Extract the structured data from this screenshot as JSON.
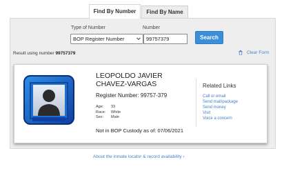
{
  "tabs": [
    {
      "label": "Find By Number",
      "active": true
    },
    {
      "label": "Find By Name",
      "active": false
    }
  ],
  "search": {
    "type_label": "Type of Number",
    "type_value": "BOP Register Number",
    "number_label": "Number",
    "number_value": "99757379",
    "search_button": "Search"
  },
  "result": {
    "prefix": "Result using number",
    "number": "99757379",
    "clear_label": "Clear Form"
  },
  "inmate": {
    "name": "LEOPOLDO JAVIER CHAVEZ-VARGAS",
    "register": "Register Number: 99757-379",
    "facts": [
      {
        "key": "Age:",
        "value": "33"
      },
      {
        "key": "Race:",
        "value": "White"
      },
      {
        "key": "Sex:",
        "value": "Male"
      }
    ],
    "custody": "Not in BOP Custody as of: 07/06/2021"
  },
  "related": {
    "title": "Related Links",
    "links": [
      "Call or email",
      "Send mail/package",
      "Send money",
      "Visit",
      "Voice a concern"
    ]
  },
  "footer": {
    "about": "About the inmate locator & record availability ›"
  },
  "colors": {
    "accent": "#3b8fd9",
    "link": "#4a82c4",
    "panel": "#eeeeee"
  }
}
